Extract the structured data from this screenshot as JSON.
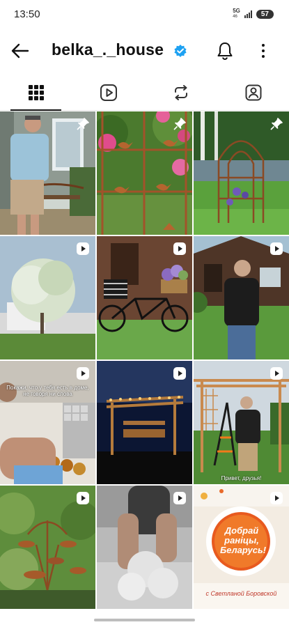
{
  "status_bar": {
    "time": "13:50",
    "network": "5G",
    "signal_sub": "46",
    "battery": "57"
  },
  "header": {
    "username": "belka_._house",
    "verified": true,
    "back_icon": "arrow-left-icon",
    "notifications_icon": "bell-icon",
    "more_icon": "more-vertical-icon"
  },
  "tabs": [
    {
      "id": "grid",
      "icon": "grid-icon",
      "active": true
    },
    {
      "id": "reels",
      "icon": "reels-icon",
      "active": false
    },
    {
      "id": "reposts",
      "icon": "repost-icon",
      "active": false
    },
    {
      "id": "tagged",
      "icon": "tagged-person-icon",
      "active": false
    }
  ],
  "posts": [
    {
      "type": "pinned",
      "subject": "man-by-house-with-bench"
    },
    {
      "type": "pinned",
      "subject": "rusty-trellis-with-peonies"
    },
    {
      "type": "pinned",
      "subject": "rusty-garden-arch"
    },
    {
      "type": "reel",
      "subject": "willow-tree"
    },
    {
      "type": "reel",
      "subject": "bicycle-flower-basket"
    },
    {
      "type": "reel",
      "subject": "man-on-lawn"
    },
    {
      "type": "reel",
      "subject": "kitchen-jars",
      "caption": "Покажи, что у тебя есть в доме, не говоря ни слова"
    },
    {
      "type": "reel",
      "subject": "pergola-swing-night"
    },
    {
      "type": "reel",
      "subject": "wooden-pergola-man",
      "caption": "Привет, друзья!"
    },
    {
      "type": "reel",
      "subject": "metal-bowls-garden"
    },
    {
      "type": "reel",
      "subject": "man-working-dust"
    },
    {
      "type": "reel",
      "subject": "tv-show-logo",
      "logo_text": "Добрай раніцы, Беларусь!",
      "logo_sub": "с Светланой Боровской"
    }
  ],
  "colors": {
    "verified": "#1DA1F2",
    "text": "#111111"
  }
}
